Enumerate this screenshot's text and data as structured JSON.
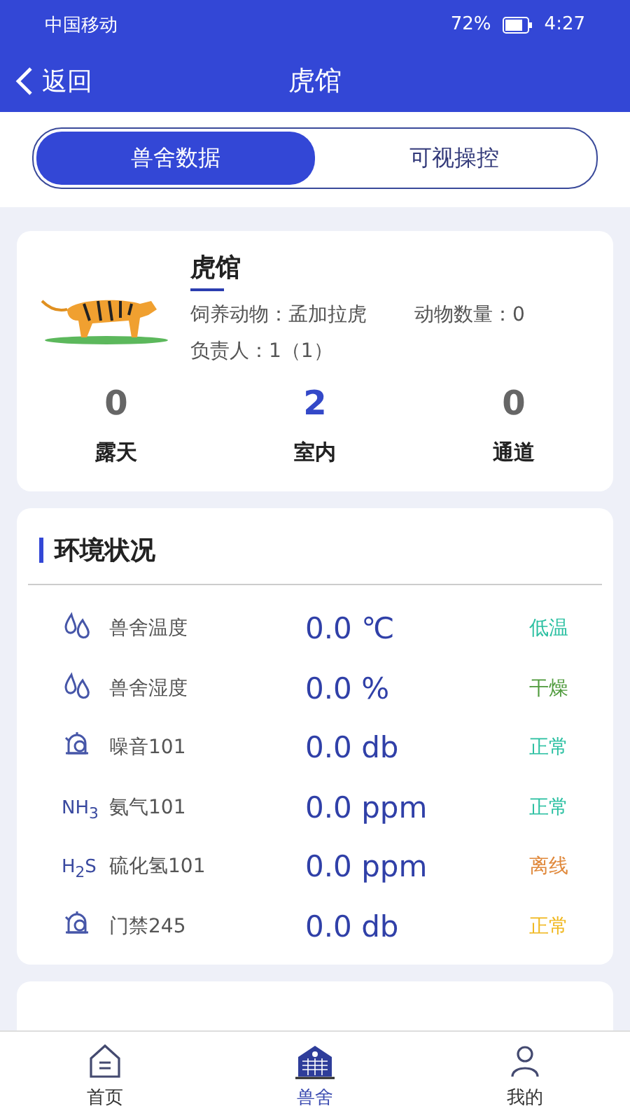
{
  "status_bar": {
    "carrier": "中国移动",
    "battery": "72%",
    "time": "4:27"
  },
  "header": {
    "back": "返回",
    "title": "虎馆"
  },
  "tabs": [
    {
      "label": "兽舍数据",
      "selected": true
    },
    {
      "label": "可视操控",
      "selected": false
    }
  ],
  "enclosure": {
    "name": "虎馆",
    "animal": "饲养动物：孟加拉虎",
    "count": "动物数量：0",
    "keeper": "负责人：1（1）",
    "stats": [
      {
        "value": "0",
        "label": "露天",
        "highlight": false
      },
      {
        "value": "2",
        "label": "室内",
        "highlight": true
      },
      {
        "value": "0",
        "label": "通道",
        "highlight": false
      }
    ]
  },
  "environment": {
    "title": "环境状况",
    "rows": [
      {
        "kind": "drops",
        "name": "兽舍温度",
        "value": "0.0 ℃",
        "status": "低温",
        "color": "#2cc0a2"
      },
      {
        "kind": "drops",
        "name": "兽舍湿度",
        "value": "0.0 %",
        "status": "干燥",
        "color": "#4f9a3c"
      },
      {
        "kind": "alarm",
        "name": "噪音101",
        "value": "0.0 db",
        "status": "正常",
        "color": "#2cc0a2"
      },
      {
        "kind": "formula",
        "icon_text": "NH$_{3}$",
        "name": "氨气101",
        "value": "0.0 ppm",
        "status": "正常",
        "color": "#2cc0a2"
      },
      {
        "kind": "formula",
        "icon_text": "H$_{2}$S",
        "name": "硫化氢101",
        "value": "0.0 ppm",
        "status": "离线",
        "color": "#e0883a"
      },
      {
        "kind": "alarm",
        "name": "门禁245",
        "value": "0.0 db",
        "status": "正常",
        "color": "#f0b820"
      }
    ]
  },
  "nav": [
    {
      "label": "首页",
      "kind": "home",
      "selected": false
    },
    {
      "label": "兽舍",
      "kind": "building",
      "selected": true
    },
    {
      "label": "我的",
      "kind": "person",
      "selected": false
    }
  ]
}
